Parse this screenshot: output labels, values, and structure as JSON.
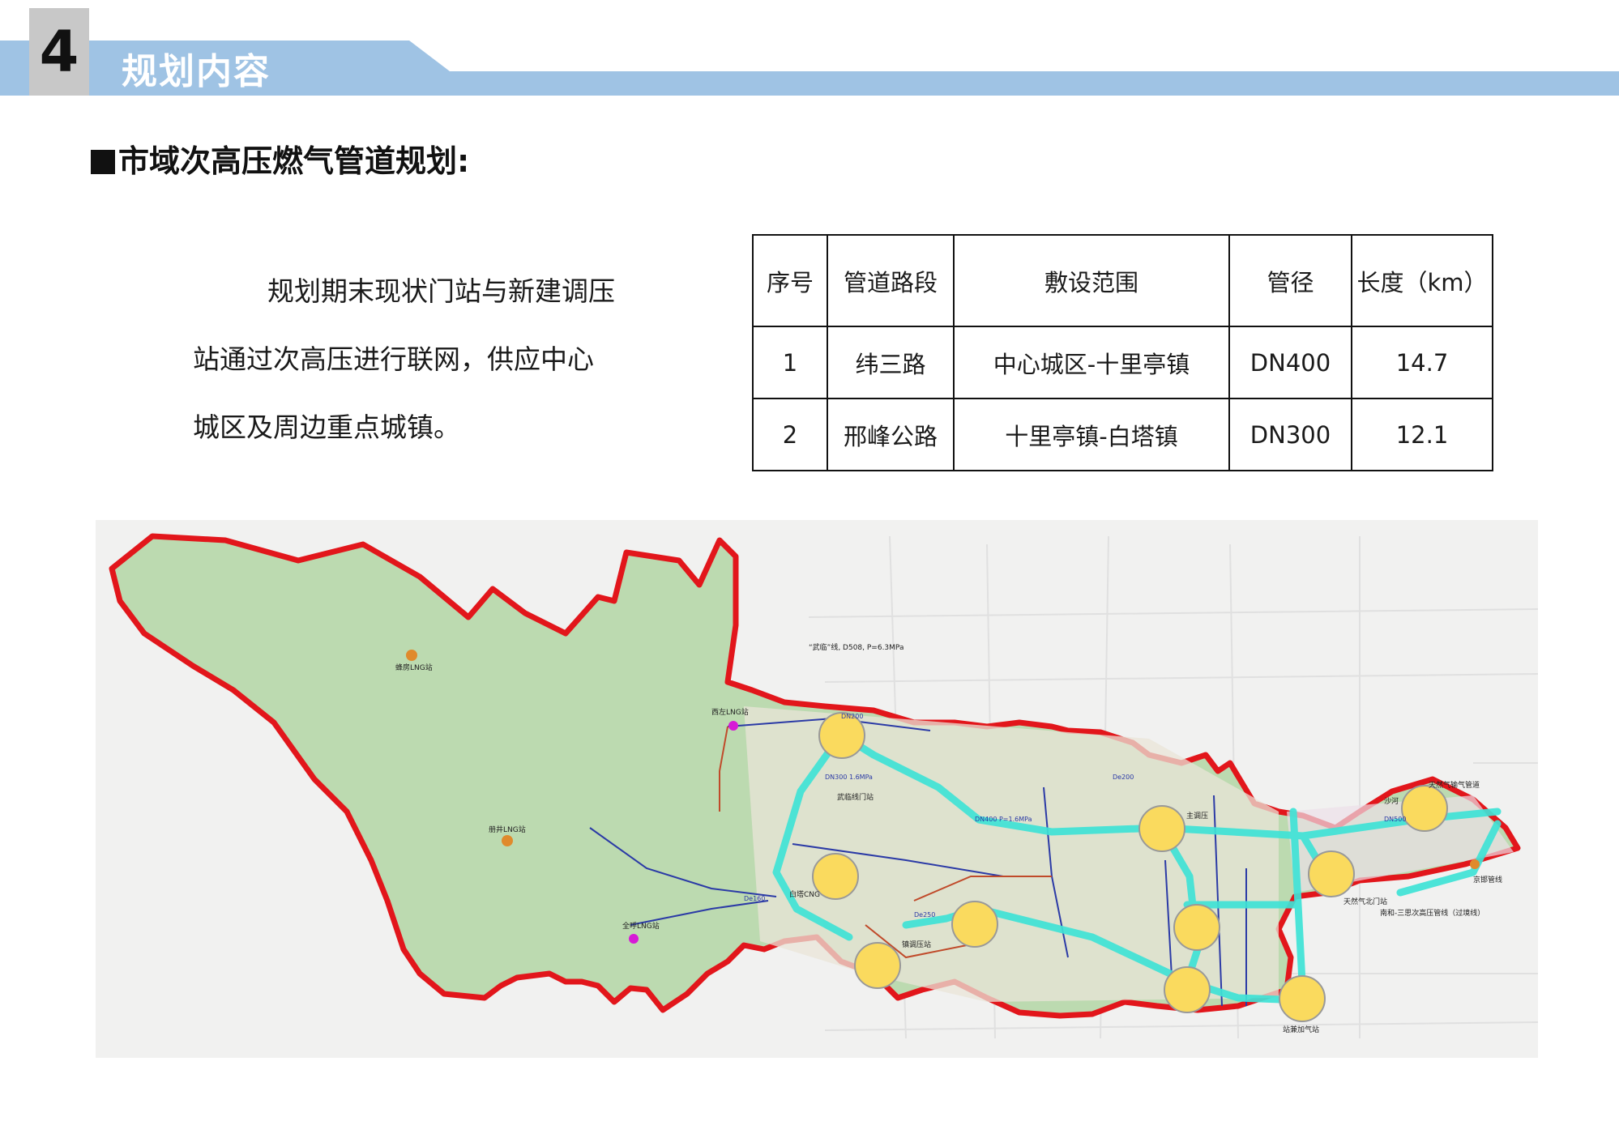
{
  "header": {
    "number": "4",
    "title": "规划内容"
  },
  "section_title": "市域次高压燃气管道规划:",
  "intro": {
    "line1": "规划期末现状门站与新建调压",
    "line2": "站通过次高压进行联网，供应中心",
    "line3": "城区及周边重点城镇。"
  },
  "table": {
    "headers": [
      "序号",
      "管道路段",
      "敷设范围",
      "管径",
      "长度（km）"
    ],
    "rows": [
      [
        "1",
        "纬三路",
        "中心城区-十里亭镇",
        "DN400",
        "14.7"
      ],
      [
        "2",
        "邢峰公路",
        "十里亭镇-白塔镇",
        "DN300",
        "12.1"
      ]
    ]
  },
  "map": {
    "labels": {
      "fengfang": "蜂房LNG站",
      "xizuo": "西左LNG站",
      "cejing": "册井LNG站",
      "quanhu": "全呼LNG站",
      "wulin_line": "“武临”线, D508, P=6.3MPa",
      "wulin_gate": "武临线门站",
      "baita": "白塔CNG",
      "tiaoya_zhen": "镇调压站",
      "tiaoya_zhu": "主调压",
      "beimen": "天然气北门站",
      "shahe": "沙河",
      "jingyang_top": "天然气输气管道",
      "jinghan": "京邯管线",
      "nanhe": "南和-三思次高压管线（过境线）",
      "jiaqi": "站兼加气站",
      "dn200": "DN200",
      "de200": "De200",
      "dn400": "DN400 P=1.6MPa",
      "dn300": "DN300 1.6MPa",
      "de160": "De160",
      "de250": "De250",
      "dn500": "DN500"
    },
    "colors": {
      "boundary": "#e2161b",
      "land": "#b9d9ad",
      "pipeline": "#3fe3d6",
      "node": "#fada5e",
      "lng": "#e08a2c",
      "cng": "#d61ad6"
    }
  }
}
